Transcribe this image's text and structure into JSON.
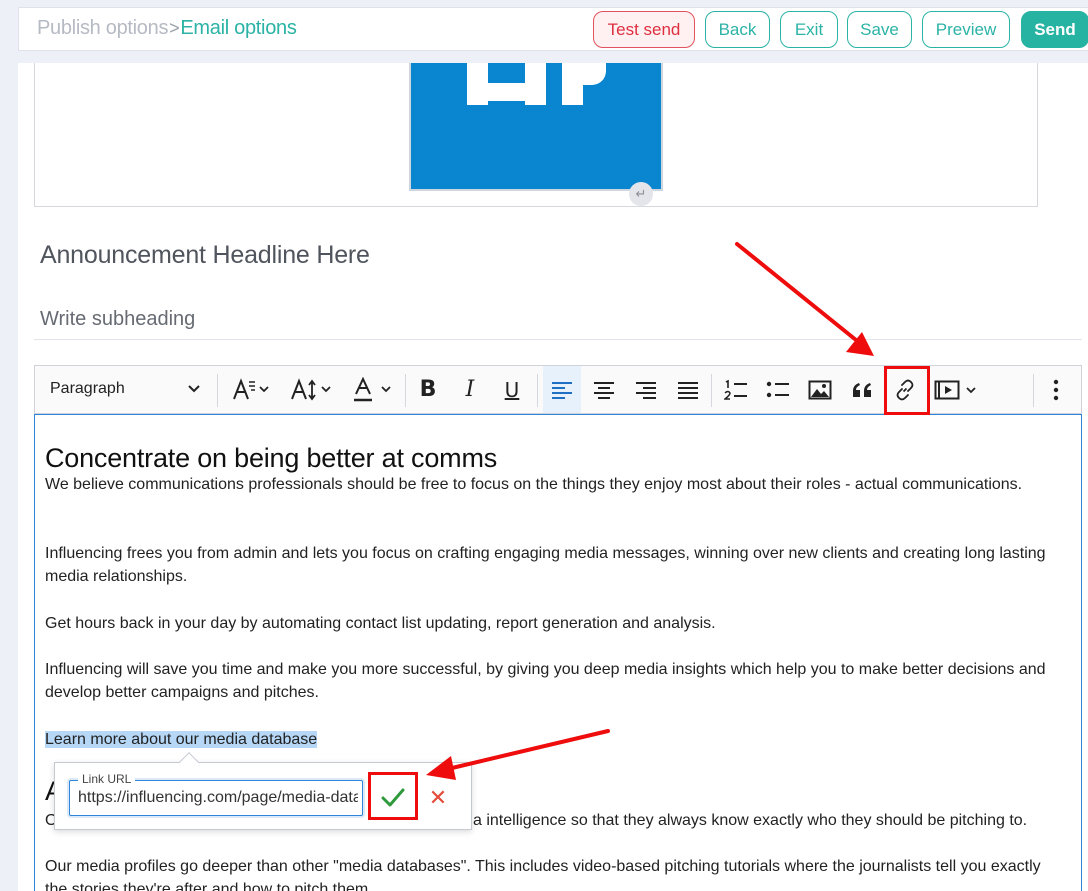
{
  "topbar": {
    "crumb_parent": "Publish options",
    "crumb_separator": ">",
    "crumb_current": "Email options",
    "buttons": {
      "test_send": "Test send",
      "back": "Back",
      "exit": "Exit",
      "save": "Save",
      "preview": "Preview",
      "send": "Send"
    }
  },
  "header": {
    "logo_icon": "hp-logo-image",
    "return_icon": "return-arrow-icon",
    "return_glyph": "↵"
  },
  "headline": "Announcement Headline Here",
  "subheading": "Write subheading",
  "toolbar": {
    "paragraph_style": "Paragraph",
    "icons": [
      "chevron-down-icon",
      "font-size-icon",
      "line-height-icon",
      "font-color-icon",
      "bold-icon",
      "italic-icon",
      "underline-icon",
      "align-left-icon",
      "align-center-icon",
      "align-right-icon",
      "justify-icon",
      "numbered-list-icon",
      "bulleted-list-icon",
      "insert-image-icon",
      "blockquote-icon",
      "link-icon",
      "media-embed-icon",
      "more-icon"
    ],
    "active_color": "#e6f1fb"
  },
  "editor": {
    "heading": "Concentrate on being better at comms",
    "paragraphs": [
      "We believe communications professionals should be free to focus on the things they enjoy most about their roles - actual communications.",
      "Influencing frees you from admin and lets you focus on crafting engaging media messages, winning over new clients and creating long lasting media relationships.",
      "Get hours back in your day by automating contact list updating, report generation and analysis.",
      "Influencing will save you time and make you more successful, by giving you deep media insights which help you to make better decisions and develop better campaigns and pitches."
    ],
    "selected_text": "Learn more about our media database",
    "heading_2_visible": "A",
    "partial_line_left": "O",
    "partial_line_right": "a intelligence so that they always know exactly who they should be pitching to.",
    "paragraph_last": "Our media profiles go deeper than other \"media databases\". This includes video-based pitching tutorials where the journalists tell you exactly the stories they're after and how to pitch them."
  },
  "link_balloon": {
    "label": "Link URL",
    "value": "https://influencing.com/page/media-database",
    "save_icon": "checkmark-icon",
    "cancel_icon": "close-icon",
    "cancel_glyph": "✕"
  },
  "annotations": {
    "color": "#ee0c0c"
  },
  "colors": {
    "brand_teal": "#2bb3a5",
    "danger": "#de2f40",
    "editor_focus": "#2f86d8",
    "selection": "#b6d7f6"
  }
}
